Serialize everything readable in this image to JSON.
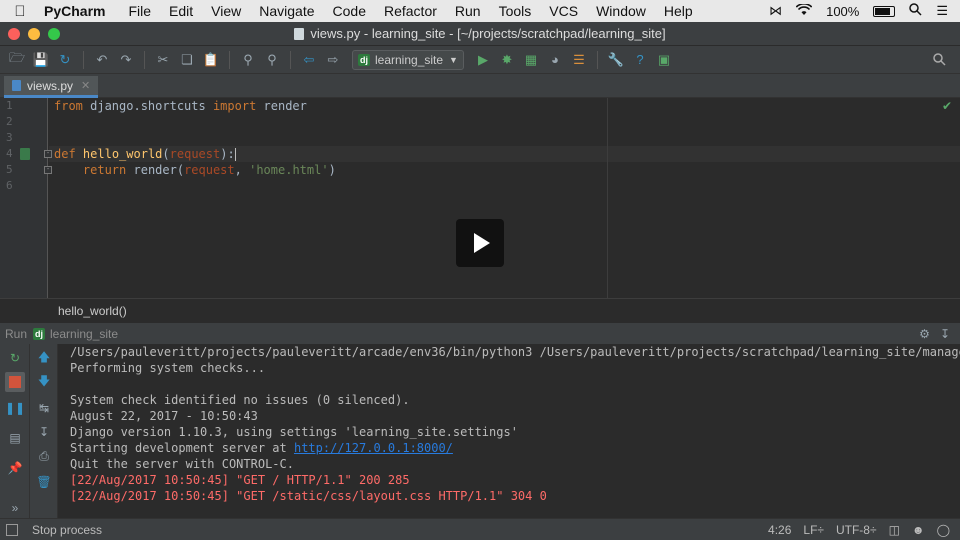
{
  "menubar": {
    "app": "PyCharm",
    "menus": [
      "File",
      "Edit",
      "View",
      "Navigate",
      "Code",
      "Refactor",
      "Run",
      "Tools",
      "VCS",
      "Window",
      "Help"
    ],
    "battery": "100%"
  },
  "window": {
    "title": "views.py - learning_site - [~/projects/scratchpad/learning_site]"
  },
  "toolbar": {
    "run_config": "learning_site"
  },
  "editor": {
    "tab": "views.py",
    "line_numbers": [
      "1",
      "2",
      "3",
      "4",
      "5",
      "6"
    ],
    "code": {
      "l1_kw1": "from",
      "l1_mod": " django.shortcuts ",
      "l1_kw2": "import",
      "l1_name": " render",
      "l4_kw": "def",
      "l4_fn": "hello_world",
      "l4_open": "(",
      "l4_param": "request",
      "l4_close": "):",
      "l5_indent": "    ",
      "l5_kw": "return",
      "l5_call": " render(",
      "l5_arg": "request",
      "l5_comma": ", ",
      "l5_str": "'home.html'",
      "l5_end": ")"
    },
    "breadcrumb": "hello_world()"
  },
  "run_panel": {
    "label": "Run",
    "config": "learning_site",
    "console": {
      "lines": [
        "/Users/pauleveritt/projects/pauleveritt/arcade/env36/bin/python3 /Users/pauleveritt/projects/scratchpad/learning_site/manage.py",
        "Performing system checks...",
        "",
        "System check identified no issues (0 silenced).",
        "August 22, 2017 - 10:50:43",
        "Django version 1.10.3, using settings 'learning_site.settings'"
      ],
      "server_prefix": "Starting development server at ",
      "server_url": "http://127.0.0.1:8000/",
      "quit": "Quit the server with CONTROL-C.",
      "log_lines": [
        "[22/Aug/2017 10:50:45] \"GET / HTTP/1.1\" 200 285",
        "[22/Aug/2017 10:50:45] \"GET /static/css/layout.css HTTP/1.1\" 304 0"
      ]
    }
  },
  "statusbar": {
    "message": "Stop process",
    "position": "4:26",
    "line_sep": "LF÷",
    "encoding": "UTF-8÷"
  }
}
